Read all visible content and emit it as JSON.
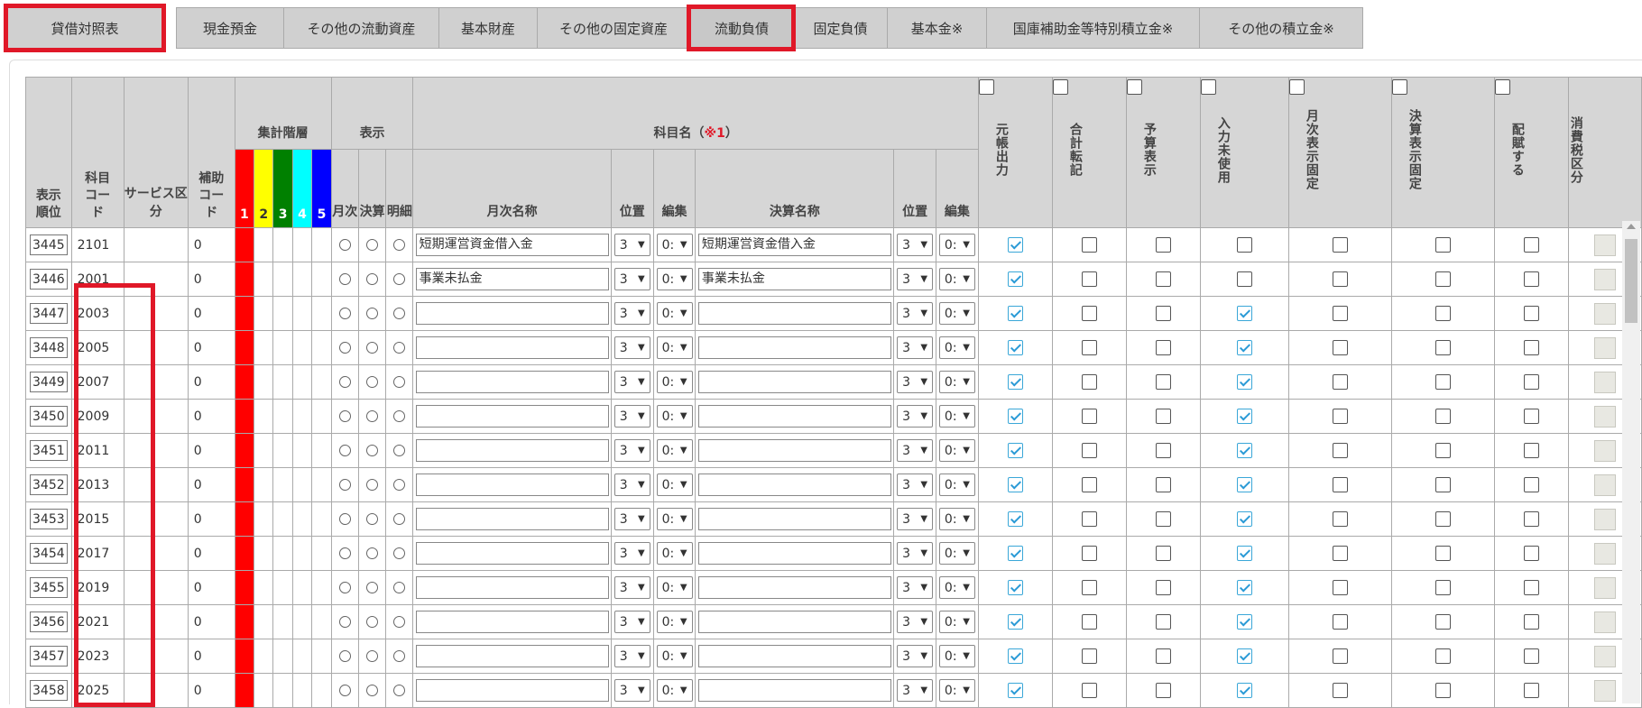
{
  "top_button": "貸借対照表",
  "tabs": [
    {
      "label": "現金預金",
      "w": 119
    },
    {
      "label": "その他の流動資産",
      "w": 172
    },
    {
      "label": "基本財産",
      "w": 109
    },
    {
      "label": "その他の固定資産",
      "w": 169
    },
    {
      "label": "流動負債",
      "w": 115,
      "active": true
    },
    {
      "label": "固定負債",
      "w": 104
    },
    {
      "label": "基本金※",
      "w": 110
    },
    {
      "label": "国庫補助金等特別積立金※",
      "w": 236
    },
    {
      "label": "その他の積立金※",
      "w": 182
    }
  ],
  "headers": {
    "order": "表示順位",
    "code": "科目コード",
    "service": "サービス区分",
    "sub_code": "補助コード",
    "levels_group": "集計階層",
    "levels": [
      "1",
      "2",
      "3",
      "4",
      "5"
    ],
    "level_colors": [
      "#ff0000",
      "#ffff00",
      "#008000",
      "#00ffff",
      "#0000ff"
    ],
    "display_group": "表示",
    "display": [
      "月次",
      "決算",
      "明細"
    ],
    "name_group": "科目名（",
    "name_group_mark": "※1",
    "name_group_end": "）",
    "monthly_name": "月次名称",
    "pos": "位置",
    "edit": "編集",
    "settle_name": "決算名称",
    "flags": [
      "元帳出力",
      "合計転記",
      "予算表示",
      "入力未使用",
      "月次表示固定",
      "決算表示固定",
      "配賦する",
      "消費税区分"
    ]
  },
  "rows": [
    {
      "order": "3445",
      "code": "2101",
      "sub": "0",
      "mname": "短期運営資金借入金",
      "mpos": "3",
      "medit": "0:",
      "sname": "短期運営資金借入金",
      "spos": "3",
      "sedit": "0:",
      "ledger": true,
      "unused": false
    },
    {
      "order": "3446",
      "code": "2001",
      "sub": "0",
      "mname": "事業未払金",
      "mpos": "3",
      "medit": "0:",
      "sname": "事業未払金",
      "spos": "3",
      "sedit": "0:",
      "ledger": true,
      "unused": false
    },
    {
      "order": "3447",
      "code": "2003",
      "sub": "0",
      "mname": "",
      "mpos": "3",
      "medit": "0:",
      "sname": "",
      "spos": "3",
      "sedit": "0:",
      "ledger": true,
      "unused": true
    },
    {
      "order": "3448",
      "code": "2005",
      "sub": "0",
      "mname": "",
      "mpos": "3",
      "medit": "0:",
      "sname": "",
      "spos": "3",
      "sedit": "0:",
      "ledger": true,
      "unused": true
    },
    {
      "order": "3449",
      "code": "2007",
      "sub": "0",
      "mname": "",
      "mpos": "3",
      "medit": "0:",
      "sname": "",
      "spos": "3",
      "sedit": "0:",
      "ledger": true,
      "unused": true
    },
    {
      "order": "3450",
      "code": "2009",
      "sub": "0",
      "mname": "",
      "mpos": "3",
      "medit": "0:",
      "sname": "",
      "spos": "3",
      "sedit": "0:",
      "ledger": true,
      "unused": true
    },
    {
      "order": "3451",
      "code": "2011",
      "sub": "0",
      "mname": "",
      "mpos": "3",
      "medit": "0:",
      "sname": "",
      "spos": "3",
      "sedit": "0:",
      "ledger": true,
      "unused": true
    },
    {
      "order": "3452",
      "code": "2013",
      "sub": "0",
      "mname": "",
      "mpos": "3",
      "medit": "0:",
      "sname": "",
      "spos": "3",
      "sedit": "0:",
      "ledger": true,
      "unused": true
    },
    {
      "order": "3453",
      "code": "2015",
      "sub": "0",
      "mname": "",
      "mpos": "3",
      "medit": "0:",
      "sname": "",
      "spos": "3",
      "sedit": "0:",
      "ledger": true,
      "unused": true
    },
    {
      "order": "3454",
      "code": "2017",
      "sub": "0",
      "mname": "",
      "mpos": "3",
      "medit": "0:",
      "sname": "",
      "spos": "3",
      "sedit": "0:",
      "ledger": true,
      "unused": true
    },
    {
      "order": "3455",
      "code": "2019",
      "sub": "0",
      "mname": "",
      "mpos": "3",
      "medit": "0:",
      "sname": "",
      "spos": "3",
      "sedit": "0:",
      "ledger": true,
      "unused": true
    },
    {
      "order": "3456",
      "code": "2021",
      "sub": "0",
      "mname": "",
      "mpos": "3",
      "medit": "0:",
      "sname": "",
      "spos": "3",
      "sedit": "0:",
      "ledger": true,
      "unused": true
    },
    {
      "order": "3457",
      "code": "2023",
      "sub": "0",
      "mname": "",
      "mpos": "3",
      "medit": "0:",
      "sname": "",
      "spos": "3",
      "sedit": "0:",
      "ledger": true,
      "unused": true
    },
    {
      "order": "3458",
      "code": "2025",
      "sub": "0",
      "mname": "",
      "mpos": "3",
      "medit": "0:",
      "sname": "",
      "spos": "3",
      "sedit": "0:",
      "ledger": true,
      "unused": true
    }
  ]
}
